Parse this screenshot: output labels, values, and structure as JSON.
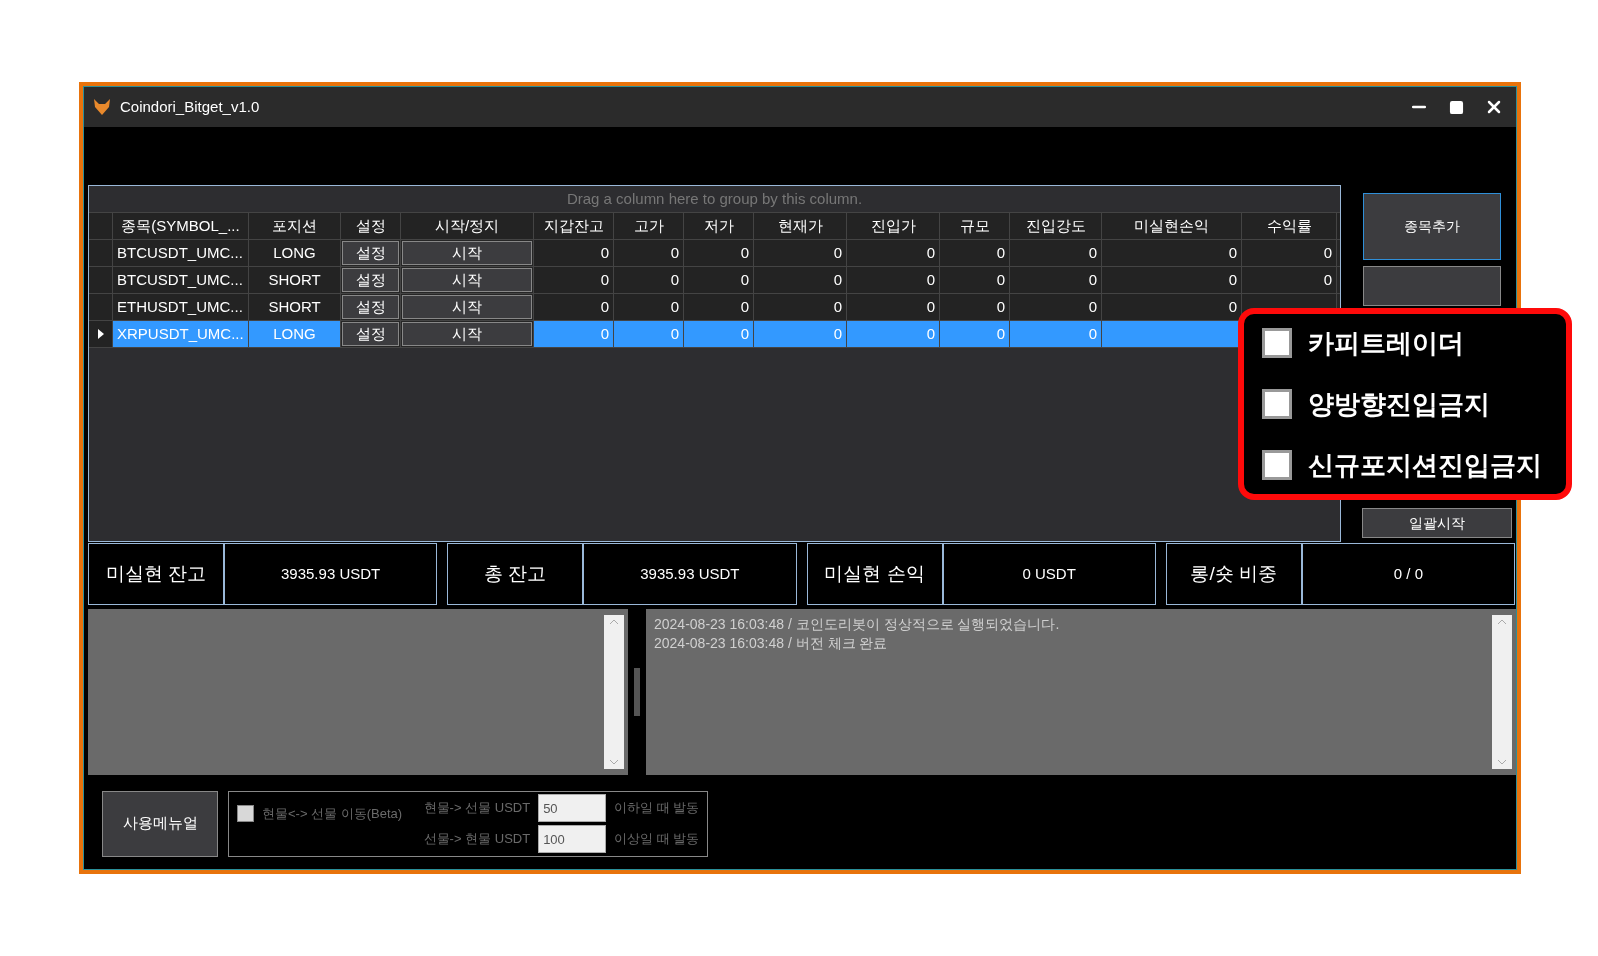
{
  "window": {
    "title": "Coindori_Bitget_v1.0"
  },
  "grid": {
    "group_panel_hint": "Drag a column here to group by this column.",
    "columns": [
      "종목(SYMBOL_...",
      "포지션",
      "설정",
      "시작/정지",
      "지갑잔고",
      "고가",
      "저가",
      "현재가",
      "진입가",
      "규모",
      "진입강도",
      "미실현손익",
      "수익률"
    ],
    "rows": [
      {
        "selected": false,
        "symbol": "BTCUSDT_UMC...",
        "position": "LONG",
        "settings_button": "설정",
        "start_button": "시작",
        "values": [
          "0",
          "0",
          "0",
          "0",
          "0",
          "0",
          "0",
          "0",
          "0"
        ]
      },
      {
        "selected": false,
        "symbol": "BTCUSDT_UMC...",
        "position": "SHORT",
        "settings_button": "설정",
        "start_button": "시작",
        "values": [
          "0",
          "0",
          "0",
          "0",
          "0",
          "0",
          "0",
          "0",
          "0"
        ]
      },
      {
        "selected": false,
        "symbol": "ETHUSDT_UMC...",
        "position": "SHORT",
        "settings_button": "설정",
        "start_button": "시작",
        "values": [
          "0",
          "0",
          "0",
          "0",
          "0",
          "0",
          "0",
          "0"
        ]
      },
      {
        "selected": true,
        "symbol": "XRPUSDT_UMC...",
        "position": "LONG",
        "settings_button": "설정",
        "start_button": "시작",
        "values": [
          "0",
          "0",
          "0",
          "0",
          "0",
          "0",
          "0"
        ]
      }
    ]
  },
  "side_buttons": {
    "add": "종목추가",
    "start_all": "일괄시작"
  },
  "summary": [
    {
      "label": "미실현 잔고",
      "value": "3935.93 USDT"
    },
    {
      "label": "총 잔고",
      "value": "3935.93 USDT"
    },
    {
      "label": "미실현 손익",
      "value": "0 USDT"
    },
    {
      "label": "롱/숏 비중",
      "value": "0 / 0"
    }
  ],
  "log": [
    "2024-08-23 16:03:48 / 코인도리봇이 정상적으로 실행되었습니다.",
    "2024-08-23 16:03:48 / 버전 체크 완료"
  ],
  "bottom": {
    "manual_button": "사용메뉴얼",
    "transfer": {
      "disabled": true,
      "checked": false,
      "label": "현물<-> 선물 이동(Beta)",
      "rows": [
        {
          "label": "현물-> 선물 USDT",
          "value": "50",
          "suffix": "이하일 때 발동"
        },
        {
          "label": "선물-> 현물 USDT",
          "value": "100",
          "suffix": "이상일 때 발동"
        }
      ]
    }
  },
  "callout": {
    "options": [
      {
        "label": "카피트레이더",
        "checked": false
      },
      {
        "label": "양방향진입금지",
        "checked": false
      },
      {
        "label": "신규포지션진입금지",
        "checked": false
      }
    ]
  }
}
